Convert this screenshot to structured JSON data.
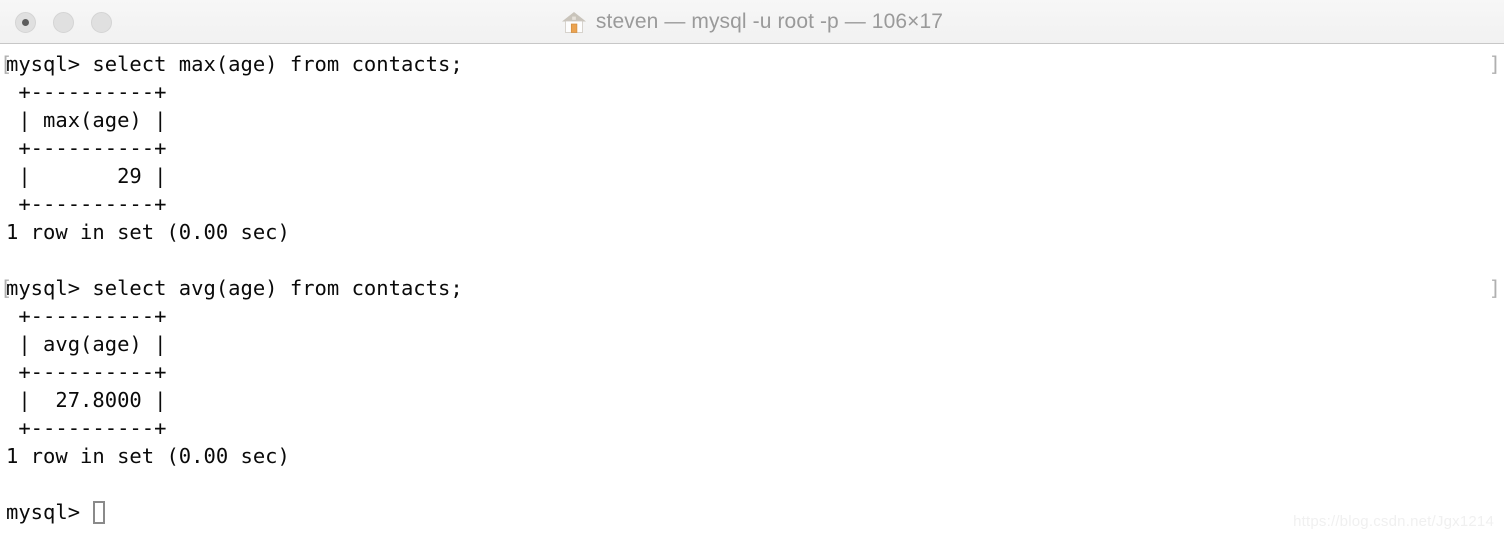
{
  "window": {
    "title": "steven — mysql -u root -p — 106×17",
    "icon": "house-icon",
    "traffic_lights": [
      {
        "name": "close-button",
        "label": "",
        "has_dot": true
      },
      {
        "name": "minimize-button",
        "label": "",
        "has_dot": false
      },
      {
        "name": "zoom-button",
        "label": "",
        "has_dot": false
      }
    ]
  },
  "terminal": {
    "prompt_mark_left": "[",
    "prompt_mark_right": "]",
    "background_color": "#ffffff",
    "text_color": "#0a0a0a",
    "mark_color": "#b0b0b0",
    "cursor_color": "#8a8a8a",
    "lines": [
      {
        "text": "mysql> select max(age) from contacts;",
        "mark": true
      },
      {
        "text": " +----------+",
        "mark": false
      },
      {
        "text": " | max(age) |",
        "mark": false
      },
      {
        "text": " +----------+",
        "mark": false
      },
      {
        "text": " |       29 |",
        "mark": false
      },
      {
        "text": " +----------+",
        "mark": false
      },
      {
        "text": "1 row in set (0.00 sec)",
        "mark": false
      },
      {
        "text": "",
        "mark": false
      },
      {
        "text": "mysql> select avg(age) from contacts;",
        "mark": true
      },
      {
        "text": " +----------+",
        "mark": false
      },
      {
        "text": " | avg(age) |",
        "mark": false
      },
      {
        "text": " +----------+",
        "mark": false
      },
      {
        "text": " |  27.8000 |",
        "mark": false
      },
      {
        "text": " +----------+",
        "mark": false
      },
      {
        "text": "1 row in set (0.00 sec)",
        "mark": false
      },
      {
        "text": "",
        "mark": false
      },
      {
        "text": "mysql> ",
        "mark": false,
        "cursor": true
      }
    ]
  },
  "watermark": {
    "text": "https://blog.csdn.net/Jgx1214"
  }
}
